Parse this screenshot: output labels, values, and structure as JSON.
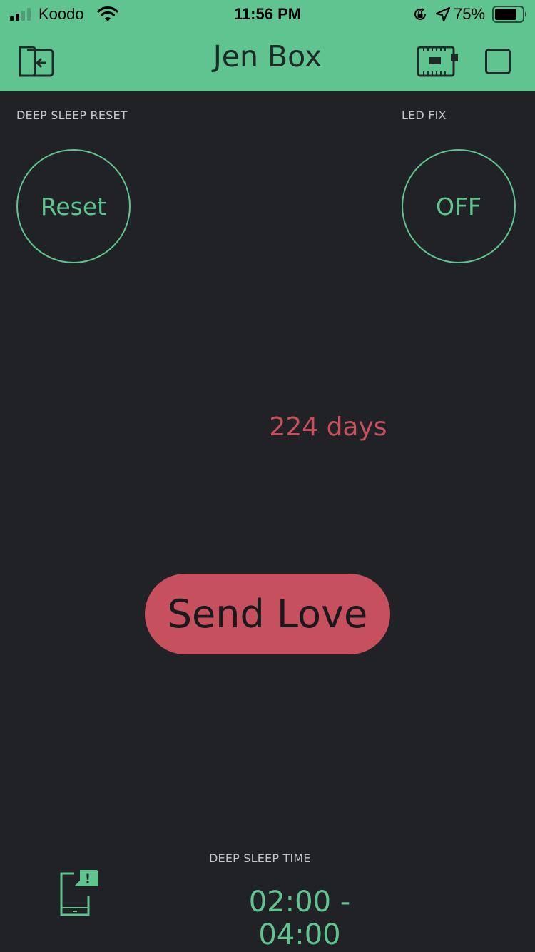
{
  "status_bar": {
    "carrier": "Koodo",
    "time": "11:56 PM",
    "battery_percent": "75%"
  },
  "header": {
    "title": "Jen Box"
  },
  "widgets": {
    "deep_sleep_reset": {
      "label": "DEEP SLEEP RESET",
      "button_text": "Reset"
    },
    "led_fix": {
      "label": "LED FIX",
      "button_text": "OFF"
    },
    "days_display": {
      "value": "224 days"
    },
    "send_love": {
      "button_text": "Send Love"
    },
    "deep_sleep_time": {
      "label": "DEEP SLEEP TIME",
      "value": "02:00 - 04:00"
    }
  },
  "colors": {
    "header_bg": "#5fc490",
    "background": "#212226",
    "accent_green": "#5fc490",
    "accent_red": "#c6505e"
  },
  "icons": {
    "back": "exit-app-icon",
    "device": "device-board-icon",
    "stop": "stop-icon",
    "notify": "phone-notification-icon"
  }
}
